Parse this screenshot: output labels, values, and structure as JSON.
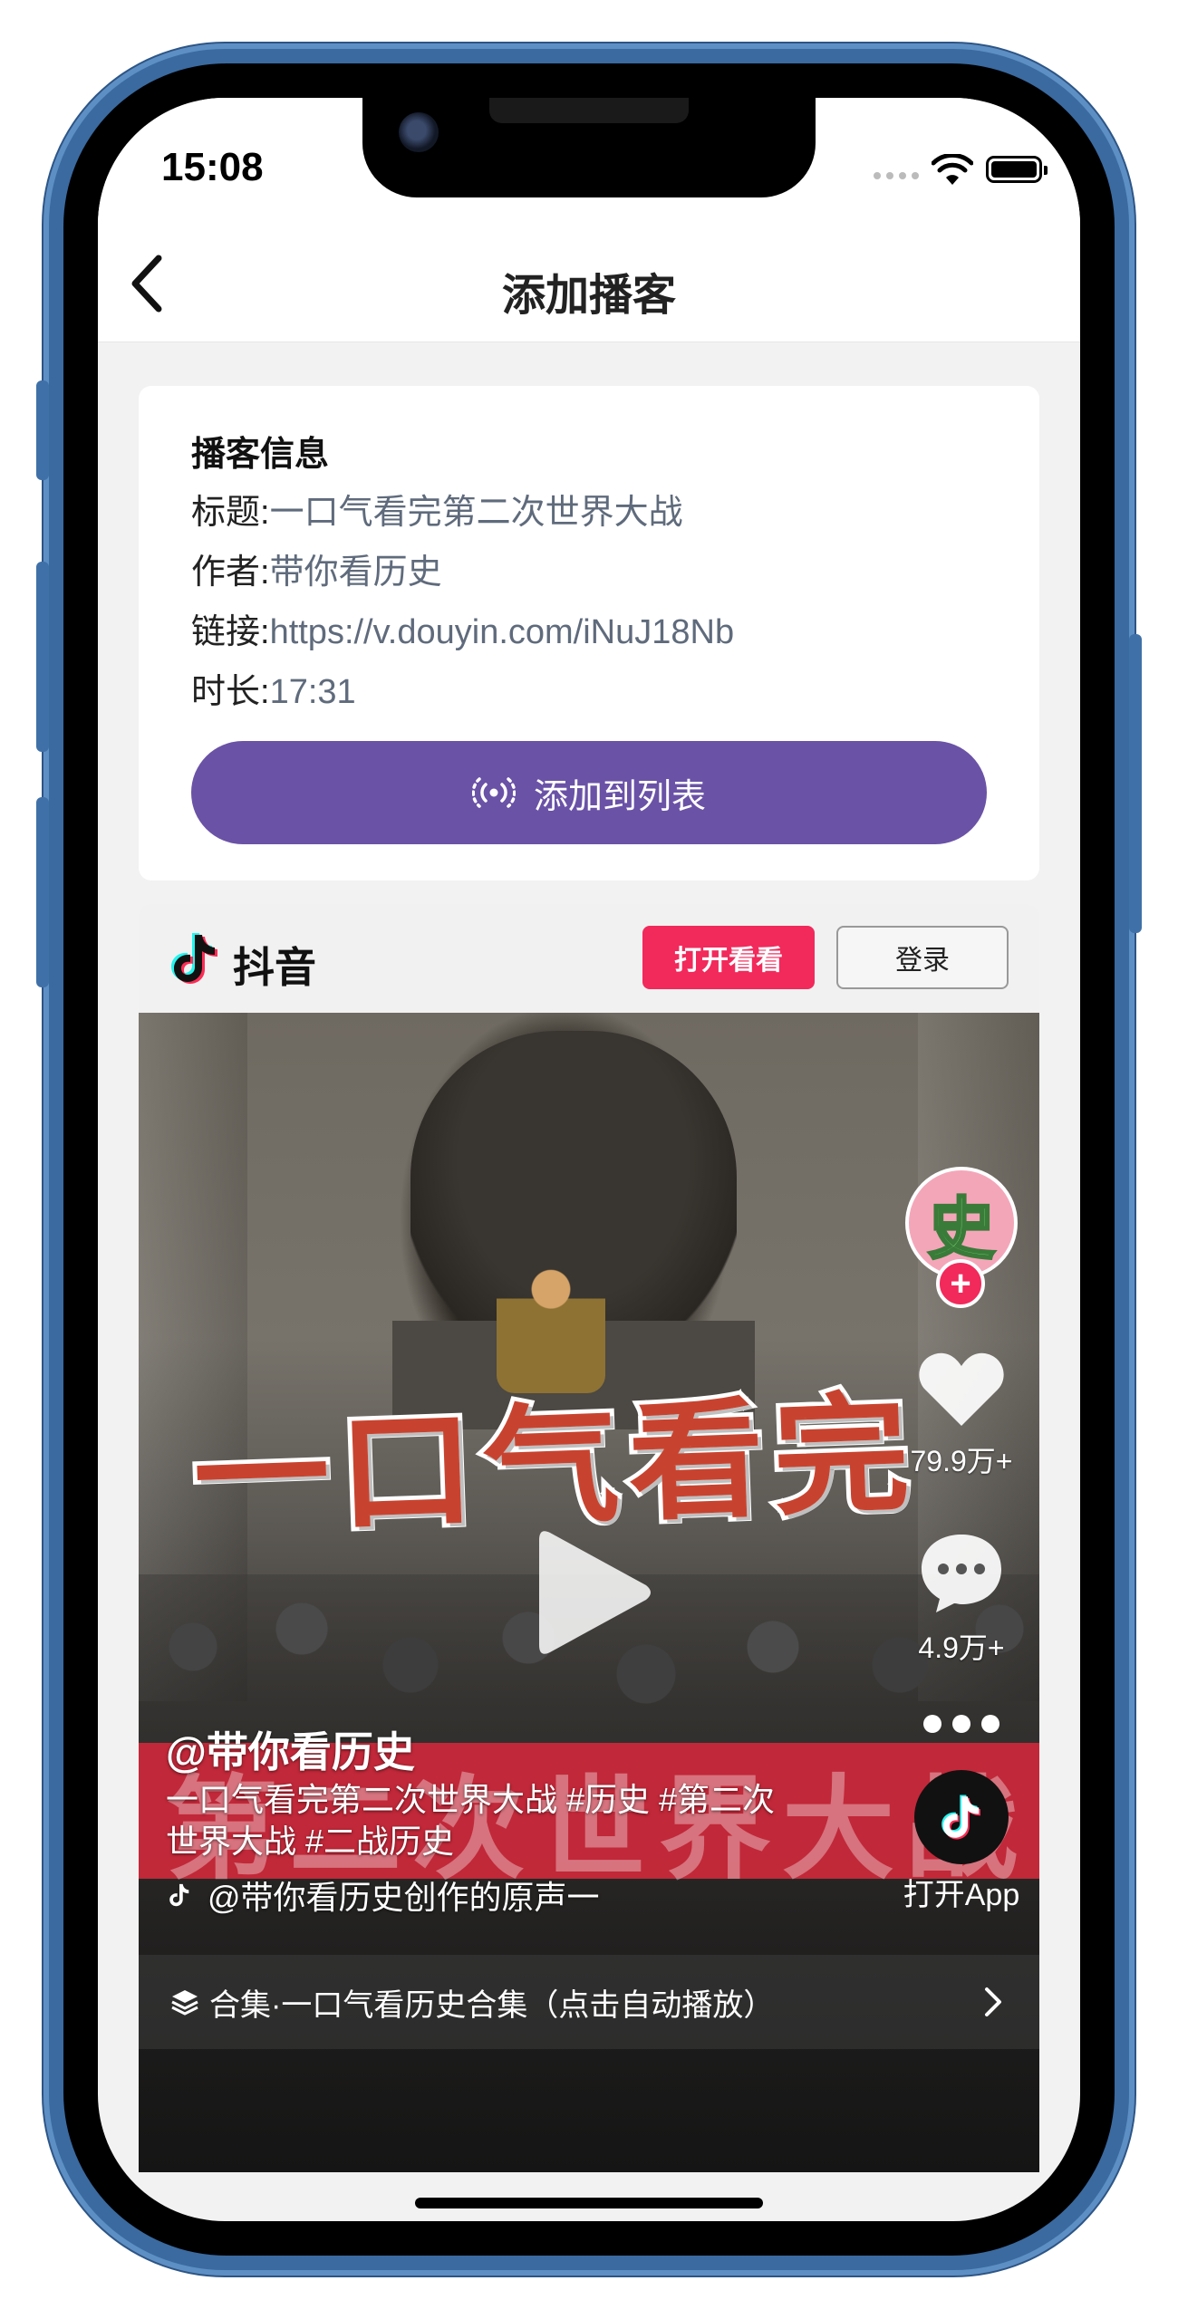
{
  "status_bar": {
    "time": "15:08"
  },
  "nav": {
    "title": "添加播客",
    "back_icon": "chevron-left-icon"
  },
  "podcast_info": {
    "heading": "播客信息",
    "title_label": "标题:",
    "title_value": "一口气看完第二次世界大战",
    "author_label": "作者:",
    "author_value": "带你看历史",
    "link_label": "链接:",
    "link_value": "https://v.douyin.com/iNuJ18Nb",
    "duration_label": "时长:",
    "duration_value": "17:31",
    "add_button": "添加到列表",
    "add_icon": "broadcast-icon",
    "accent_color": "#6a52a6"
  },
  "douyin": {
    "brand": "抖音",
    "open_button": "打开看看",
    "login_button": "登录",
    "video": {
      "overlay_title": "一口气看完",
      "overlay_subtitle": "第二次世界大战",
      "avatar_char": "史",
      "follow_plus": "+",
      "likes": "79.9万+",
      "comments": "4.9万+",
      "open_app": "打开App",
      "author": "@带你看历史",
      "description": "一口气看完第二次世界大战 #历史 #第二次世界大战 #二战历史",
      "music": "@带你看历史创作的原声一",
      "collection": "合集·一口气看历史合集（点击自动播放）"
    },
    "accent_color": "#f2295b"
  }
}
